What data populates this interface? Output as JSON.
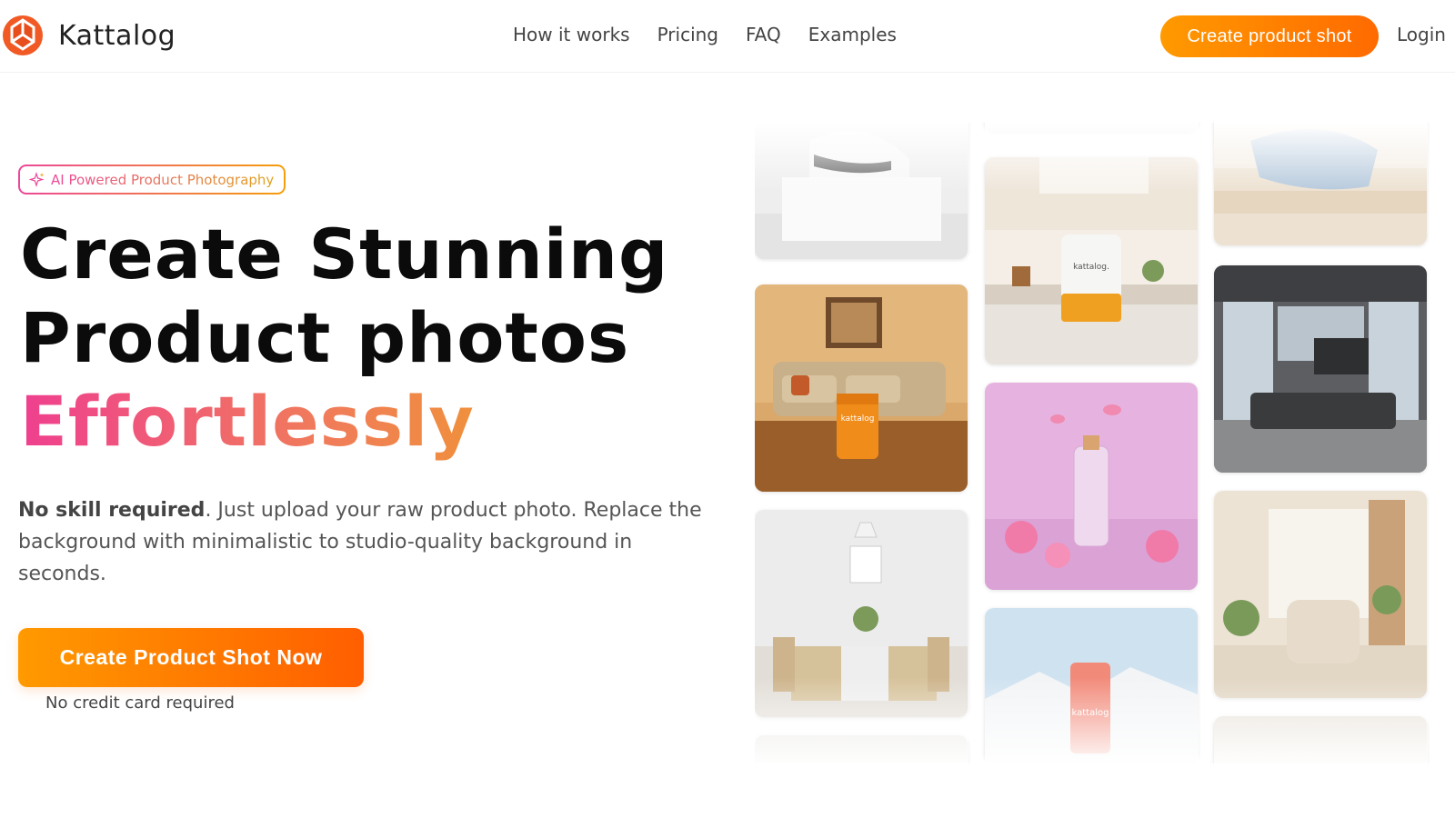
{
  "brand": {
    "name": "Kattalog",
    "accent": "#ff7a00"
  },
  "nav": {
    "items": [
      {
        "label": "How it works"
      },
      {
        "label": "Pricing"
      },
      {
        "label": "FAQ"
      },
      {
        "label": "Examples"
      }
    ]
  },
  "header": {
    "cta_label": "Create product shot",
    "login_label": "Login"
  },
  "hero": {
    "badge": "AI Powered Product Photography",
    "title_line1": "Create Stunning",
    "title_line2": "Product photos",
    "title_highlight": "Effortlessly",
    "desc_bold": "No skill required",
    "desc_rest": ". Just upload your raw product photo. Replace the background with minimalistic to studio-quality background in seconds.",
    "cta_label": "Create Product Shot Now",
    "cta_note": "No credit card required"
  },
  "gallery": {
    "images": [
      {
        "name": "sneaker-on-podium"
      },
      {
        "name": "kitchen-counter-pouch",
        "label": "kattalog."
      },
      {
        "name": "bedroom-pillow"
      },
      {
        "name": "living-room-pouch",
        "label": "kattalog"
      },
      {
        "name": "modern-apartment-sofa"
      },
      {
        "name": "pink-flowers-perfume"
      },
      {
        "name": "dining-room"
      },
      {
        "name": "snowy-mountain-can",
        "label": "kattalog"
      },
      {
        "name": "sunlit-armchair-room"
      }
    ]
  }
}
